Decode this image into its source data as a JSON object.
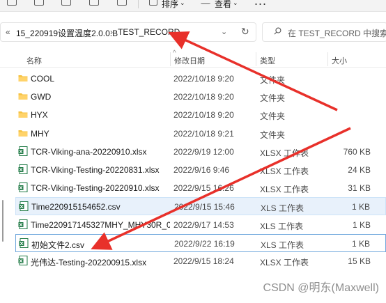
{
  "toolbar": {
    "sort_label": "排序",
    "view_label": "查看",
    "more_label": "..."
  },
  "address": {
    "overflow": "«",
    "crumbs": [
      "15_220919设置温度2.0.0.B",
      "TEST_RECORD"
    ],
    "separator": "›"
  },
  "search": {
    "placeholder": "在 TEST_RECORD 中搜索"
  },
  "columns": {
    "name": "名称",
    "date": "修改日期",
    "type": "类型",
    "size": "大小"
  },
  "files": [
    {
      "name": "COOL",
      "date": "2022/10/18 9:20",
      "type": "文件夹",
      "size": "",
      "icon": "folder-icon"
    },
    {
      "name": "GWD",
      "date": "2022/10/18 9:20",
      "type": "文件夹",
      "size": "",
      "icon": "folder-icon"
    },
    {
      "name": "HYX",
      "date": "2022/10/18 9:20",
      "type": "文件夹",
      "size": "",
      "icon": "folder-icon"
    },
    {
      "name": "MHY",
      "date": "2022/10/18 9:21",
      "type": "文件夹",
      "size": "",
      "icon": "folder-icon"
    },
    {
      "name": "TCR-Viking-ana-20220910.xlsx",
      "date": "2022/9/19 12:00",
      "type": "XLSX 工作表",
      "size": "760 KB",
      "icon": "excel-icon"
    },
    {
      "name": "TCR-Viking-Testing-20220831.xlsx",
      "date": "2022/9/16 9:46",
      "type": "XLSX 工作表",
      "size": "24 KB",
      "icon": "excel-icon"
    },
    {
      "name": "TCR-Viking-Testing-20220910.xlsx",
      "date": "2022/9/15 16:26",
      "type": "XLSX 工作表",
      "size": "31 KB",
      "icon": "excel-icon"
    },
    {
      "name": "Time220915154652.csv",
      "date": "2022/9/15 15:46",
      "type": "XLS 工作表",
      "size": "1 KB",
      "icon": "excel-icon"
    },
    {
      "name": "Time220917145327MHY_MHY30R_0...",
      "date": "2022/9/17 14:53",
      "type": "XLS 工作表",
      "size": "1 KB",
      "icon": "excel-icon"
    },
    {
      "name": "初始文件2.csv",
      "date": "2022/9/22 16:19",
      "type": "XLS 工作表",
      "size": "1 KB",
      "icon": "excel-icon"
    },
    {
      "name": "光伟达-Testing-202200915.xlsx",
      "date": "2022/9/15 18:24",
      "type": "XLSX 工作表",
      "size": "15 KB",
      "icon": "excel-icon"
    }
  ],
  "watermark": "CSDN @明东(Maxwell)",
  "colors": {
    "folder": "#f5c242",
    "excel": "#1f7a45",
    "arrow": "#e8302a",
    "selection": "#e8f1fb"
  }
}
